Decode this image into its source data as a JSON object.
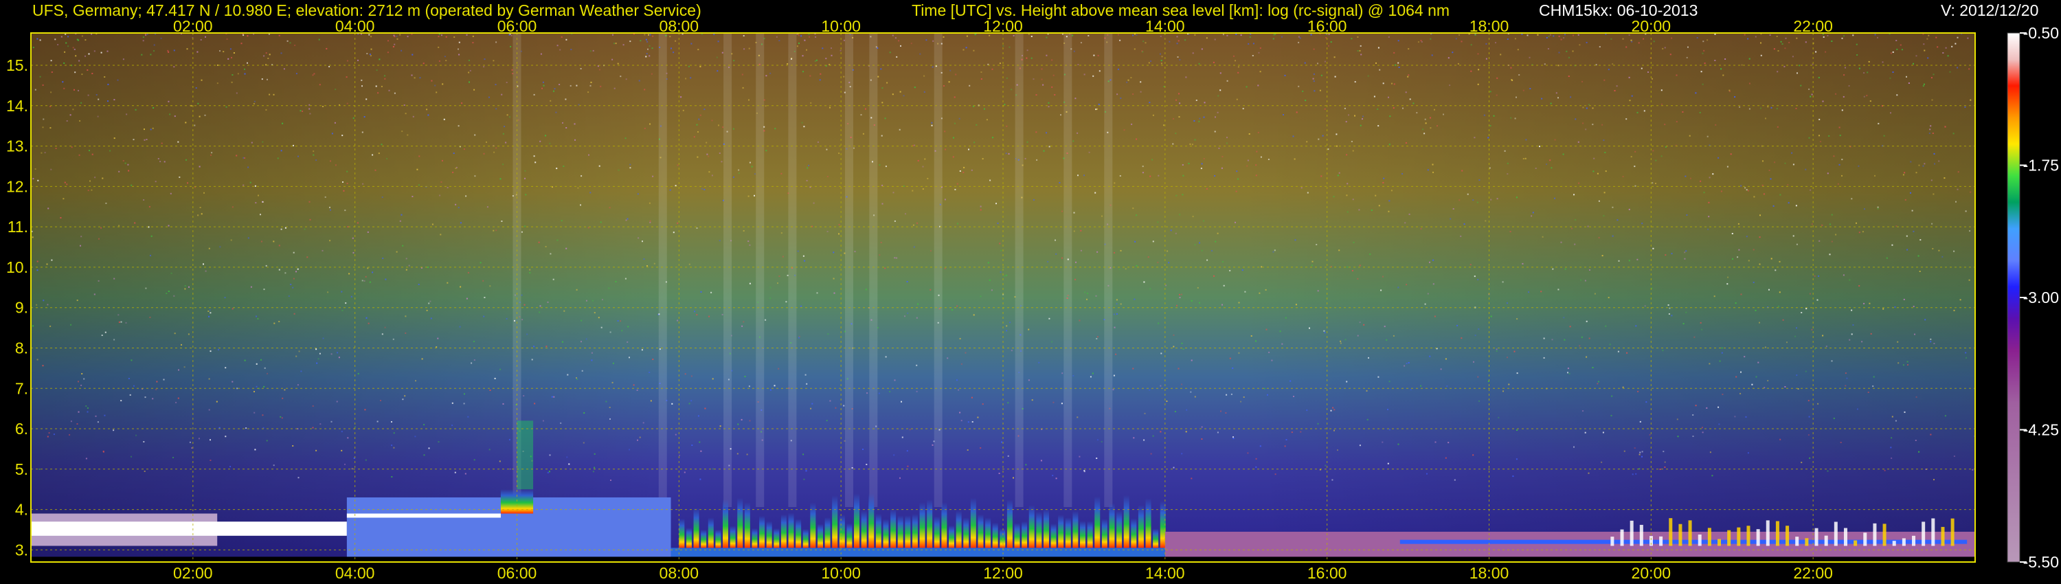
{
  "header": {
    "station": "UFS, Germany; 47.417 N / 10.980 E; elevation: 2712 m  (operated by German Weather Service)",
    "title": "Time [UTC] vs. Height above mean sea level [km]: log (rc-signal) @ 1064 nm",
    "instrument": "CHM15kx: 06-10-2013",
    "version": "V: 2012/12/20"
  },
  "chart_data": {
    "type": "heatmap",
    "title": "Time [UTC] vs. Height above mean sea level [km]: log (rc-signal) @ 1064 nm",
    "x_tick_labels": [
      "02:00",
      "04:00",
      "06:00",
      "08:00",
      "10:00",
      "12:00",
      "14:00",
      "16:00",
      "18:00",
      "20:00",
      "22:00"
    ],
    "y_tick_labels": [
      "3.",
      "4.",
      "5.",
      "6.",
      "7.",
      "8.",
      "9.",
      "10.",
      "11.",
      "12.",
      "13.",
      "14.",
      "15."
    ],
    "xlim_hours": [
      0,
      24
    ],
    "ylim_km": [
      2.7,
      15.8
    ],
    "grid": true,
    "colorbar": {
      "tick_labels": [
        "-0.50",
        "-1.75",
        "-3.00",
        "-4.25",
        "-5.50"
      ],
      "range": [
        -5.5,
        -0.5
      ]
    },
    "colors": {
      "frame": "#e8e200",
      "text_yellow": "#e8e200",
      "grid": "#b8b000",
      "background": "#000000"
    }
  }
}
